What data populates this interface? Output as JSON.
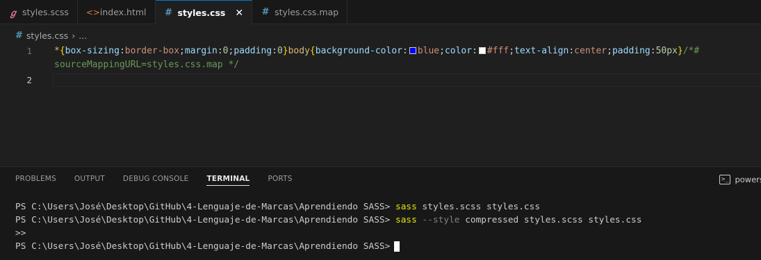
{
  "tabs": [
    {
      "label": "styles.scss",
      "icon": "sass-icon",
      "active": false
    },
    {
      "label": "index.html",
      "icon": "html-icon",
      "active": false
    },
    {
      "label": "styles.css",
      "icon": "css-icon",
      "active": true,
      "close": "✕"
    },
    {
      "label": "styles.css.map",
      "icon": "css-icon",
      "active": false
    }
  ],
  "breadcrumb": {
    "file": "styles.css",
    "separator": "›",
    "more": "..."
  },
  "editor": {
    "line1_number": "1",
    "line2_number": "2",
    "code": {
      "p1": "*",
      "p2": "{",
      "p3": "box-sizing",
      "p4": ":",
      "p5": "border-box",
      "p6": ";",
      "p7": "margin",
      "p8": ":",
      "p9": "0",
      "p10": ";",
      "p11": "padding",
      "p12": ":",
      "p13": "0",
      "p14": "}",
      "p15": "body",
      "p16": "{",
      "p17": "background-color",
      "p18": ":",
      "p19": "blue",
      "p20": ";",
      "p21": "color",
      "p22": ":",
      "p23": "#fff",
      "p24": ";",
      "p25": "text-align",
      "p26": ":",
      "p27": "center",
      "p28": ";",
      "p29": "padding",
      "p30": ":",
      "p31": "50px",
      "p32": "}",
      "p33": "/*#",
      "wrap": "sourceMappingURL=styles.css.map */"
    },
    "swatch_blue": "#0000ff",
    "swatch_white": "#ffffff"
  },
  "panel": {
    "tabs": [
      "PROBLEMS",
      "OUTPUT",
      "DEBUG CONSOLE",
      "TERMINAL",
      "PORTS"
    ],
    "active_tab": "TERMINAL",
    "shell_label": "powers"
  },
  "terminal": {
    "prompt": "PS C:\\Users\\José\\Desktop\\GitHub\\4-Lenguaje-de-Marcas\\Aprendiendo SASS> ",
    "line1_cmd": "sass",
    "line1_args": " styles.scss styles.css",
    "line2_cmd": "sass",
    "line2_flag": " --style",
    "line2_args": " compressed styles.scss styles.css",
    "line3": ">>",
    "line4_prompt": "PS C:\\Users\\José\\Desktop\\GitHub\\4-Lenguaje-de-Marcas\\Aprendiendo SASS>"
  },
  "colors": {
    "accent": "#0078d4",
    "editor_bg": "#1f1f1f",
    "panel_bg": "#181818"
  }
}
